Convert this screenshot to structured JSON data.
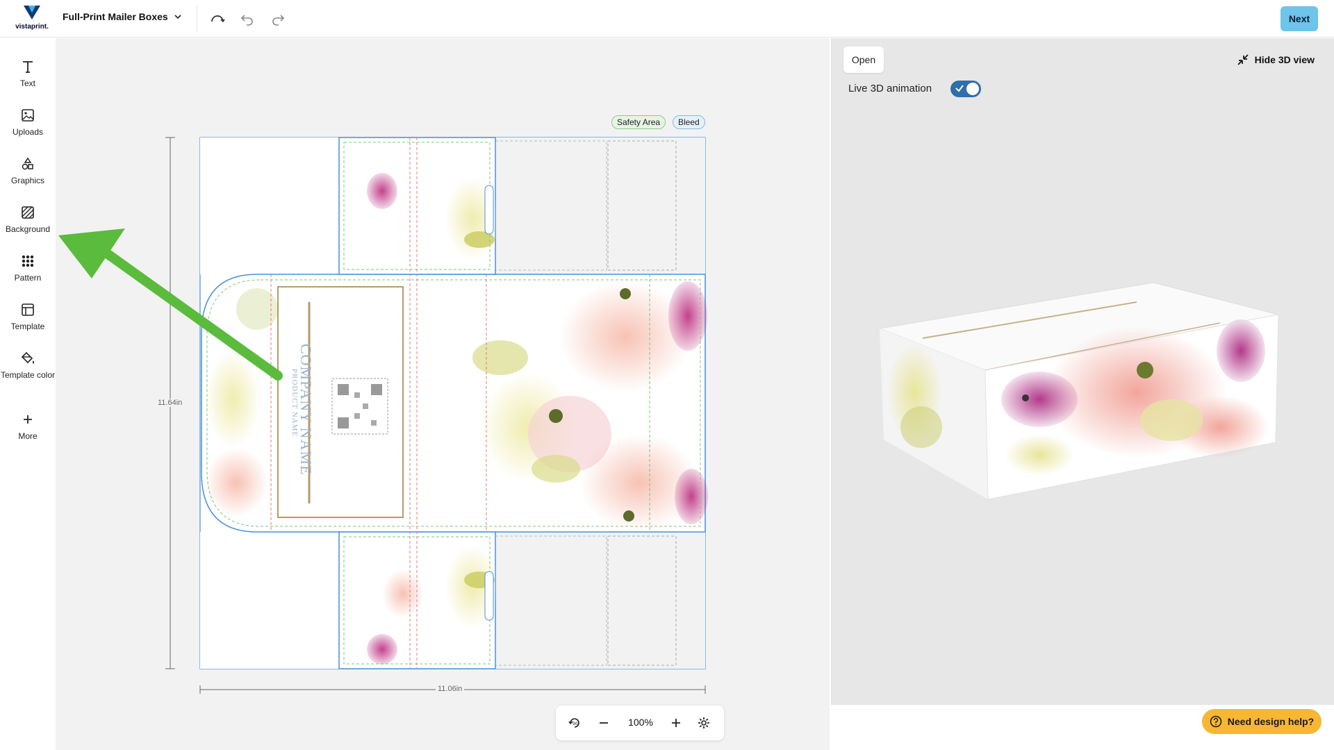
{
  "header": {
    "logo_text": "vistaprint.",
    "doc_title": "Full-Print Mailer Boxes",
    "next_label": "Next",
    "brand_color": "#6ec4ea"
  },
  "sidebar": {
    "items": [
      {
        "label": "Text",
        "icon": "text-icon"
      },
      {
        "label": "Uploads",
        "icon": "image-icon"
      },
      {
        "label": "Graphics",
        "icon": "shapes-icon"
      },
      {
        "label": "Background",
        "icon": "background-icon"
      },
      {
        "label": "Pattern",
        "icon": "pattern-icon"
      },
      {
        "label": "Template",
        "icon": "template-icon"
      },
      {
        "label": "Template color",
        "icon": "paint-bucket-icon"
      },
      {
        "label": "More",
        "icon": "plus-icon"
      }
    ]
  },
  "canvas": {
    "safety_label": "Safety Area",
    "bleed_label": "Bleed",
    "height_label": "11.64in",
    "width_label": "11.06in",
    "company_name": "COMPANY NAME",
    "product_text": "PRODUCT NAME",
    "zoom": "100%"
  },
  "preview": {
    "open_label": "Open",
    "hide_label": "Hide 3D view",
    "live_label": "Live 3D animation",
    "live_on": true
  },
  "help": {
    "label": "Need design help?"
  }
}
